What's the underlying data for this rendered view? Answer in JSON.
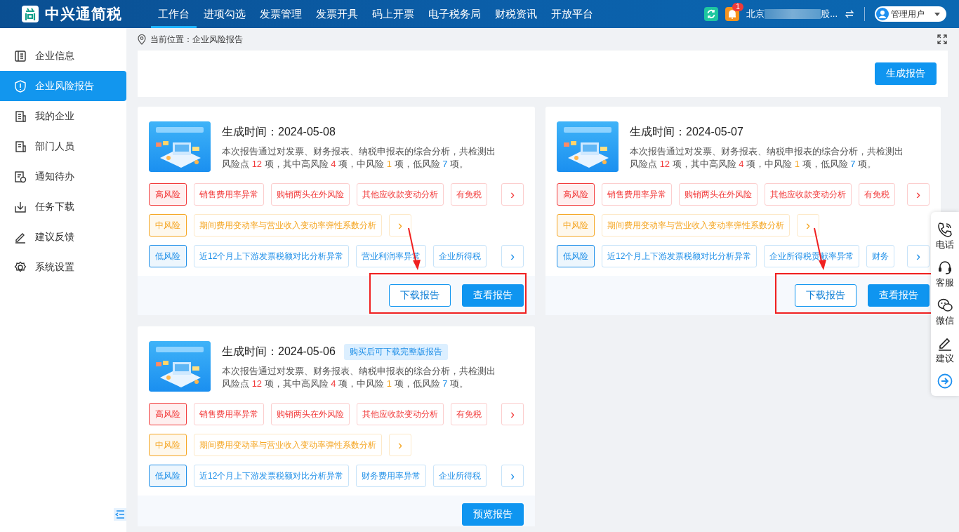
{
  "header": {
    "brand": "中兴通简税",
    "nav": [
      {
        "label": "工作台",
        "selected": true
      },
      {
        "label": "进项勾选",
        "selected": false
      },
      {
        "label": "发票管理",
        "selected": false
      },
      {
        "label": "发票开具",
        "selected": false
      },
      {
        "label": "码上开票",
        "selected": false
      },
      {
        "label": "电子税务局",
        "selected": false
      },
      {
        "label": "财税资讯",
        "selected": false
      },
      {
        "label": "开放平台",
        "selected": false
      }
    ],
    "notification_count": "1",
    "company_start": "北京",
    "company_end": "股...",
    "user": "管理用户"
  },
  "sidebar": {
    "items": [
      {
        "label": "企业信息",
        "selected": false
      },
      {
        "label": "企业风险报告",
        "selected": true
      },
      {
        "label": "我的企业",
        "selected": false
      },
      {
        "label": "部门人员",
        "selected": false
      },
      {
        "label": "通知待办",
        "selected": false
      },
      {
        "label": "任务下载",
        "selected": false
      },
      {
        "label": "建议反馈",
        "selected": false
      },
      {
        "label": "系统设置",
        "selected": false
      }
    ]
  },
  "breadcrumb": {
    "prefix": "当前位置：",
    "current": "企业风险报告"
  },
  "generate_button": "生成报告",
  "reports": [
    {
      "title": "生成时间：2024-05-08",
      "annotated": true,
      "summary": [
        {
          "text": "本次报告通过对发票、财务报表、纳税申报表的综合分析，共检测出风险点 "
        },
        {
          "text": "12",
          "color": "#f23b3b"
        },
        {
          "text": " 项，其中高风险 "
        },
        {
          "text": "4",
          "color": "#f23b3b"
        },
        {
          "text": " 项，中风险 "
        },
        {
          "text": "1",
          "color": "#f5a623"
        },
        {
          "text": " 项，低风险 "
        },
        {
          "text": "7",
          "color": "#1e8fe8"
        },
        {
          "text": " 项。"
        }
      ],
      "rows": [
        {
          "color": "#f23b3b",
          "label": "高风险",
          "items": [
            "销售费用率异常",
            "购销两头在外风险",
            "其他应收款变动分析",
            "有免税"
          ],
          "more": "›"
        },
        {
          "color": "#f5a623",
          "label": "中风险",
          "items": [
            "期间费用变动率与营业收入变动率弹性系数分析"
          ],
          "more": "›"
        },
        {
          "color": "#1e8fe8",
          "label": "低风险",
          "items": [
            "近12个月上下游发票税额对比分析异常",
            "营业利润率异常",
            "企业所得税"
          ],
          "more": "›"
        }
      ],
      "buttons": [
        {
          "label": "下载报告",
          "kind": "outline"
        },
        {
          "label": "查看报告",
          "kind": "primary"
        }
      ]
    },
    {
      "title": "生成时间：2024-05-07",
      "annotated": true,
      "summary": [
        {
          "text": "本次报告通过对发票、财务报表、纳税申报表的综合分析，共检测出风险点 "
        },
        {
          "text": "12",
          "color": "#f23b3b"
        },
        {
          "text": " 项，其中高风险 "
        },
        {
          "text": "4",
          "color": "#f23b3b"
        },
        {
          "text": " 项，中风险 "
        },
        {
          "text": "1",
          "color": "#f5a623"
        },
        {
          "text": " 项，低风险 "
        },
        {
          "text": "7",
          "color": "#1e8fe8"
        },
        {
          "text": " 项。"
        }
      ],
      "rows": [
        {
          "color": "#f23b3b",
          "label": "高风险",
          "items": [
            "销售费用率异常",
            "购销两头在外风险",
            "其他应收款变动分析",
            "有免税"
          ],
          "more": "›"
        },
        {
          "color": "#f5a623",
          "label": "中风险",
          "items": [
            "期间费用变动率与营业收入变动率弹性系数分析"
          ],
          "more": "›"
        },
        {
          "color": "#1e8fe8",
          "label": "低风险",
          "items": [
            "近12个月上下游发票税额对比分析异常",
            "企业所得税贡献率异常",
            "财务"
          ],
          "more": "›"
        }
      ],
      "buttons": [
        {
          "label": "下载报告",
          "kind": "outline"
        },
        {
          "label": "查看报告",
          "kind": "primary"
        }
      ]
    },
    {
      "title": "生成时间：2024-05-06",
      "badge": "购买后可下载完整版报告",
      "annotated": false,
      "summary": [
        {
          "text": "本次报告通过对发票、财务报表、纳税申报表的综合分析，共检测出风险点 "
        },
        {
          "text": "12",
          "color": "#f23b3b"
        },
        {
          "text": " 项，其中高风险 "
        },
        {
          "text": "4",
          "color": "#f23b3b"
        },
        {
          "text": " 项，中风险 "
        },
        {
          "text": "1",
          "color": "#f5a623"
        },
        {
          "text": " 项，低风险 "
        },
        {
          "text": "7",
          "color": "#1e8fe8"
        },
        {
          "text": " 项。"
        }
      ],
      "rows": [
        {
          "color": "#f23b3b",
          "label": "高风险",
          "items": [
            "销售费用率异常",
            "购销两头在外风险",
            "其他应收款变动分析",
            "有免税"
          ],
          "more": "›"
        },
        {
          "color": "#f5a623",
          "label": "中风险",
          "items": [
            "期间费用变动率与营业收入变动率弹性系数分析"
          ],
          "more": "›"
        },
        {
          "color": "#1e8fe8",
          "label": "低风险",
          "items": [
            "近12个月上下游发票税额对比分析异常",
            "财务费用率异常",
            "企业所得税"
          ],
          "more": "›"
        }
      ],
      "buttons": [
        {
          "label": "预览报告",
          "kind": "primary"
        }
      ]
    }
  ],
  "float_panel": {
    "items": [
      "电话",
      "客服",
      "微信",
      "建议"
    ]
  }
}
